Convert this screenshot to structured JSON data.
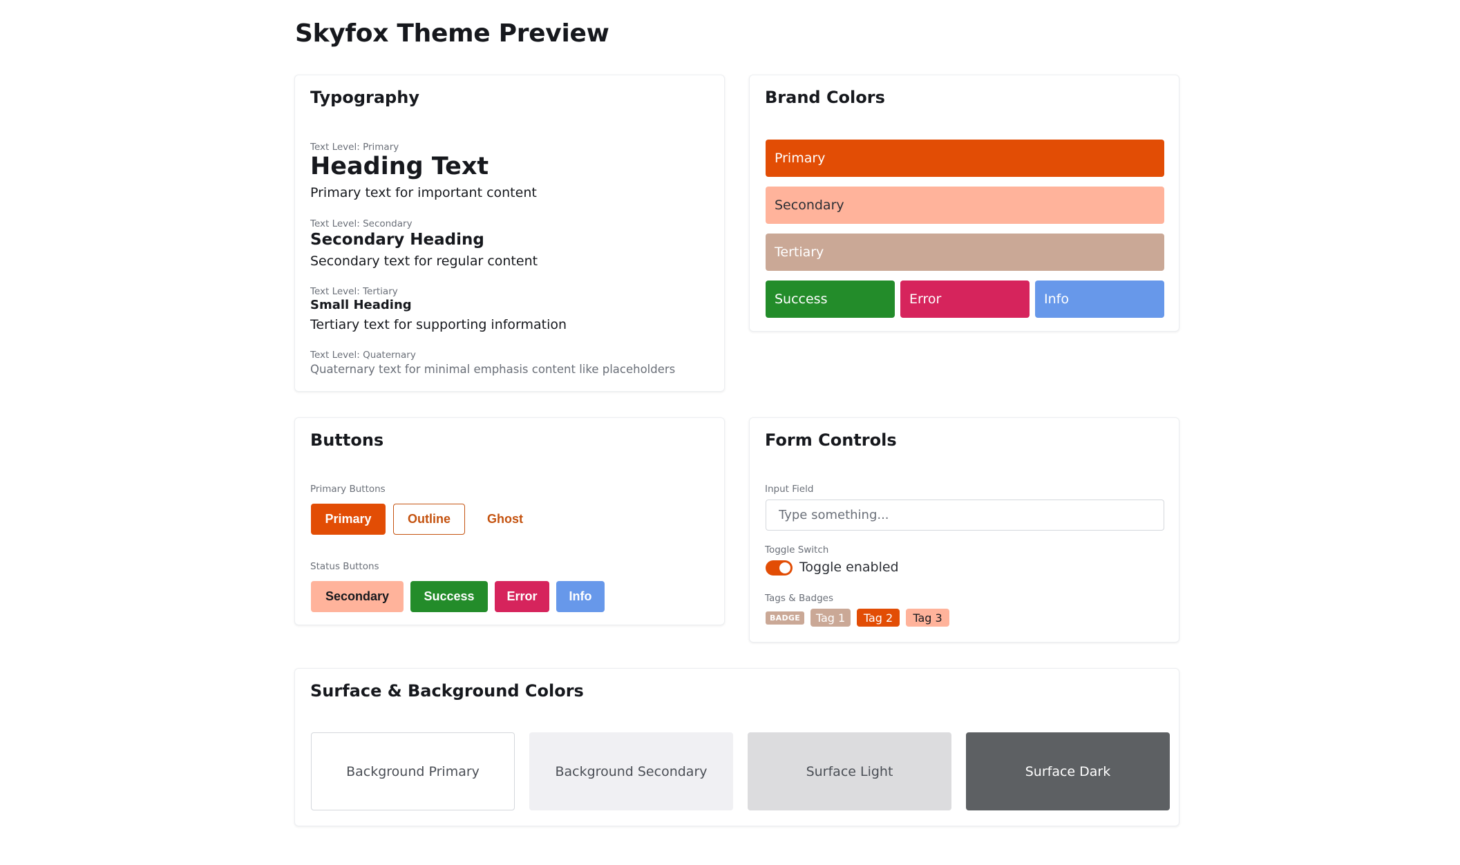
{
  "page": {
    "title": "Skyfox Theme Preview"
  },
  "typography": {
    "title": "Typography",
    "primary": {
      "level": "Text Level: Primary",
      "heading": "Heading Text",
      "text": "Primary text for important content"
    },
    "secondary": {
      "level": "Text Level: Secondary",
      "heading": "Secondary Heading",
      "text": "Secondary text for regular content"
    },
    "tertiary": {
      "level": "Text Level: Tertiary",
      "heading": "Small Heading",
      "text": "Tertiary text for supporting information"
    },
    "quaternary": {
      "level": "Text Level: Quaternary",
      "text": "Quaternary text for minimal emphasis content like placeholders"
    }
  },
  "brand": {
    "title": "Brand Colors",
    "primary": {
      "label": "Primary",
      "color": "#e24d05"
    },
    "secondary": {
      "label": "Secondary",
      "color": "#ffb39b"
    },
    "tertiary": {
      "label": "Tertiary",
      "color": "#caa896"
    },
    "success": {
      "label": "Success",
      "color": "#238c2a"
    },
    "error": {
      "label": "Error",
      "color": "#d6245c"
    },
    "info": {
      "label": "Info",
      "color": "#6798ea"
    }
  },
  "buttons": {
    "title": "Buttons",
    "primary_label": "Primary Buttons",
    "primary": "Primary",
    "outline": "Outline",
    "ghost": "Ghost",
    "status_label": "Status Buttons",
    "secondary": "Secondary",
    "success": "Success",
    "error": "Error",
    "info": "Info"
  },
  "form": {
    "title": "Form Controls",
    "input_label": "Input Field",
    "input_placeholder": "Type something...",
    "toggle_label": "Toggle Switch",
    "toggle_text": "Toggle enabled",
    "toggle_on": true,
    "tags_label": "Tags & Badges",
    "badge": "BADGE",
    "tags": [
      "Tag 1",
      "Tag 2",
      "Tag 3"
    ]
  },
  "surface": {
    "title": "Surface & Background Colors",
    "items": [
      {
        "label": "Background Primary",
        "color": "#ffffff"
      },
      {
        "label": "Background Secondary",
        "color": "#f0f0f3"
      },
      {
        "label": "Surface Light",
        "color": "#dcdcde"
      },
      {
        "label": "Surface Dark",
        "color": "#5d6063"
      }
    ]
  }
}
